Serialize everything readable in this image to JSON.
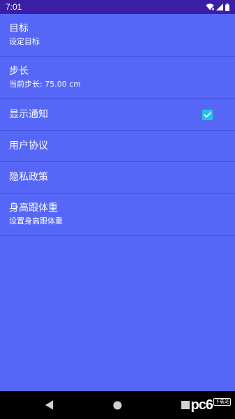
{
  "status_bar": {
    "time": "7:01",
    "icons": [
      "wifi-icon",
      "signal-icon",
      "battery-icon"
    ]
  },
  "settings": {
    "target": {
      "title": "目标",
      "summary": "设定目标"
    },
    "stride": {
      "title": "步长",
      "summary": "当前步长: 75.00 cm"
    },
    "notification": {
      "title": "显示通知",
      "checked": true
    },
    "user_agreement": {
      "title": "用户协议"
    },
    "privacy_policy": {
      "title": "隐私政策"
    },
    "height_weight": {
      "title": "身高跟体重",
      "summary": "设置身高跟体重"
    }
  },
  "nav_bar": {
    "icons": [
      "back-icon",
      "home-icon",
      "recent-apps-icon"
    ]
  },
  "watermark": {
    "text": "pc6",
    "badge": "下载站"
  },
  "colors": {
    "background": "#5667f8",
    "status_bar": "#3a1fa6",
    "checkbox": "#25c3e2",
    "nav_bar": "#000000"
  }
}
